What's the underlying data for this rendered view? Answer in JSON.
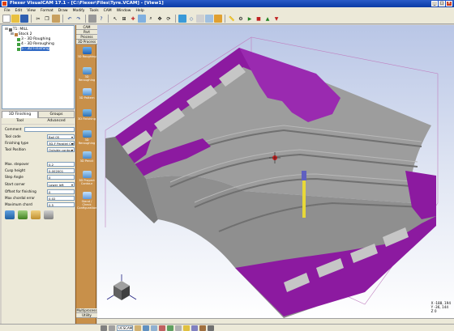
{
  "window": {
    "title": "Flexer VisualCAM 17.1 - [C:\\Flexer\\Files\\Tyre.VCAM] - [View1]"
  },
  "menu": [
    "File",
    "Edit",
    "View",
    "Format",
    "Draw",
    "Modify",
    "Tools",
    "CAM",
    "Window",
    "Help"
  ],
  "tree": {
    "root": "T1: MILL",
    "stock": "Stock 2",
    "ops": [
      {
        "label": "3 - 3D Roughing",
        "selected": false
      },
      {
        "label": "4 - 3D Reroughing",
        "selected": false
      },
      {
        "label": "5 - 3D Finishing",
        "selected": true
      }
    ]
  },
  "left_tabs": [
    "3D Finishing",
    "Groups"
  ],
  "sub_tabs": [
    "Tool",
    "Advanced"
  ],
  "props": [
    {
      "label": "Comment",
      "value": ""
    },
    {
      "label": "Tool code",
      "value": "Ball 05",
      "dropdown": true
    },
    {
      "label": "Finishing type",
      "value": "3D-F Parallel Cut",
      "dropdown": true
    },
    {
      "label": "Tool Position",
      "value": "Outside contour",
      "dropdown": true
    },
    {
      "label": "Max. stepover",
      "value": "0.2"
    },
    {
      "label": "Cusp height",
      "value": "0.002001"
    },
    {
      "label": "Step Angle",
      "value": "0"
    },
    {
      "label": "Start corner",
      "value": "Lower left",
      "dropdown": true
    },
    {
      "label": "Offset for finishing",
      "value": "0"
    },
    {
      "label": "Max chordal error",
      "value": "0.02"
    },
    {
      "label": "Maximum chord",
      "value": "0.5"
    }
  ],
  "wizard": {
    "header": [
      "CAM",
      "Part",
      "Process",
      "3D Process"
    ],
    "items": [
      "3D Roughing",
      "3D Reroughing",
      "3D Pattern",
      "3D Finishing",
      "3D Reroughing",
      "3D Pencil",
      "3D Proyect Contour",
      "Stand / Check Configuration"
    ],
    "footer": [
      "Multiprocess",
      "Utility"
    ]
  },
  "coords": {
    "x": "X -188, 194",
    "y": "Y -36, 144",
    "z": "Z 0"
  },
  "bottom": {
    "ucs": "UCSCAM"
  },
  "colors": {
    "accent": "#8c1aa0",
    "model": "#9a9a9a",
    "title": "#0a3aa5"
  }
}
